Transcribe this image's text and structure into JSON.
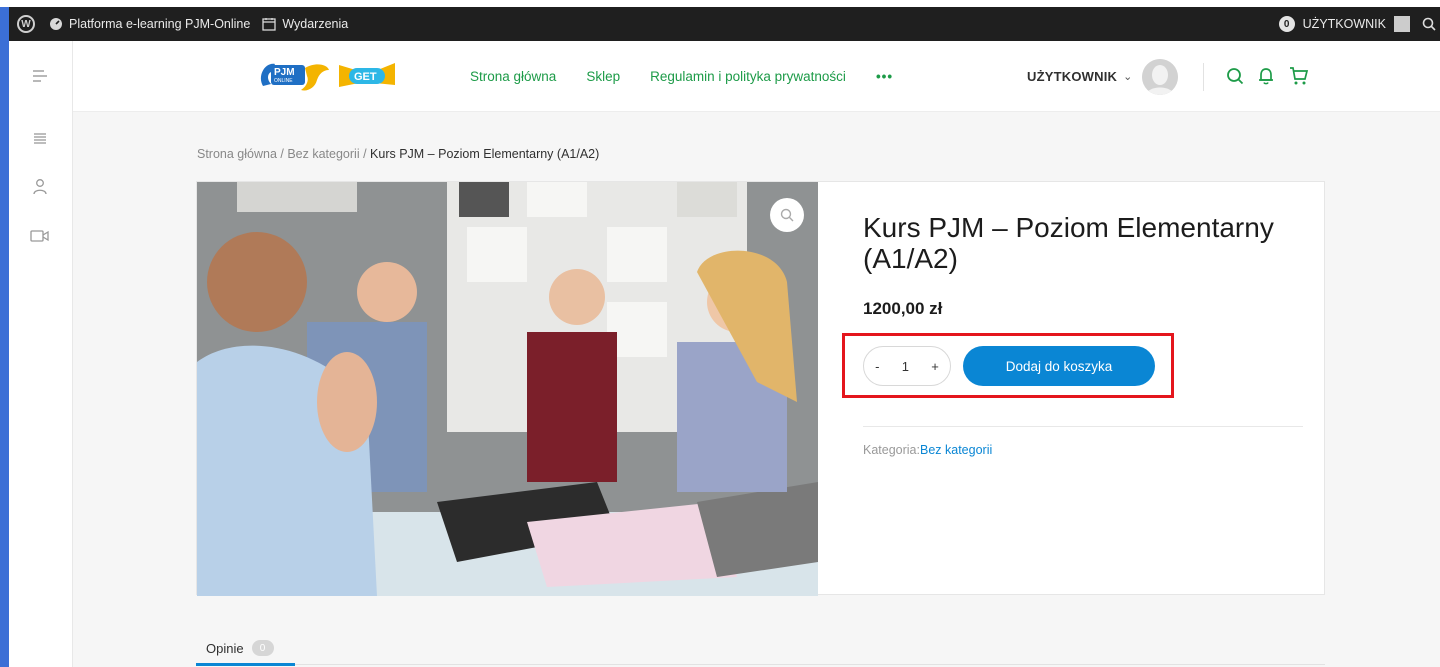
{
  "adminbar": {
    "site_name": "Platforma e-learning PJM-Online",
    "events": "Wydarzenia",
    "notifications": "0",
    "user": "UŻYTKOWNIK"
  },
  "nav": {
    "items": [
      "Strona główna",
      "Sklep",
      "Regulamin i polityka prywatności"
    ],
    "more": "•••"
  },
  "header": {
    "user_name": "UŻYTKOWNIK",
    "logo_pjm_line1": "PJM",
    "logo_pjm_line2": "ONLINE",
    "logo_get": "GET"
  },
  "breadcrumb": {
    "home": "Strona główna",
    "sep1": " / ",
    "category": "Bez kategorii",
    "sep2": " / ",
    "current": "Kurs PJM – Poziom Elementarny (A1/A2)"
  },
  "product": {
    "title": "Kurs PJM – Poziom Elementarny (A1/A2)",
    "price": "1200,00 zł",
    "qty_minus": "-",
    "qty_value": "1",
    "qty_plus": "+",
    "add_to_cart": "Dodaj do koszyka",
    "category_label": "Kategoria:",
    "category_value": "Bez kategorii"
  },
  "tabs": {
    "reviews_label": "Opinie",
    "reviews_count": "0"
  },
  "colors": {
    "accent_green": "#1d9b48",
    "accent_blue": "#0a86d4",
    "highlight_red": "#e4161d",
    "frame_blue": "#3b6fd6"
  }
}
